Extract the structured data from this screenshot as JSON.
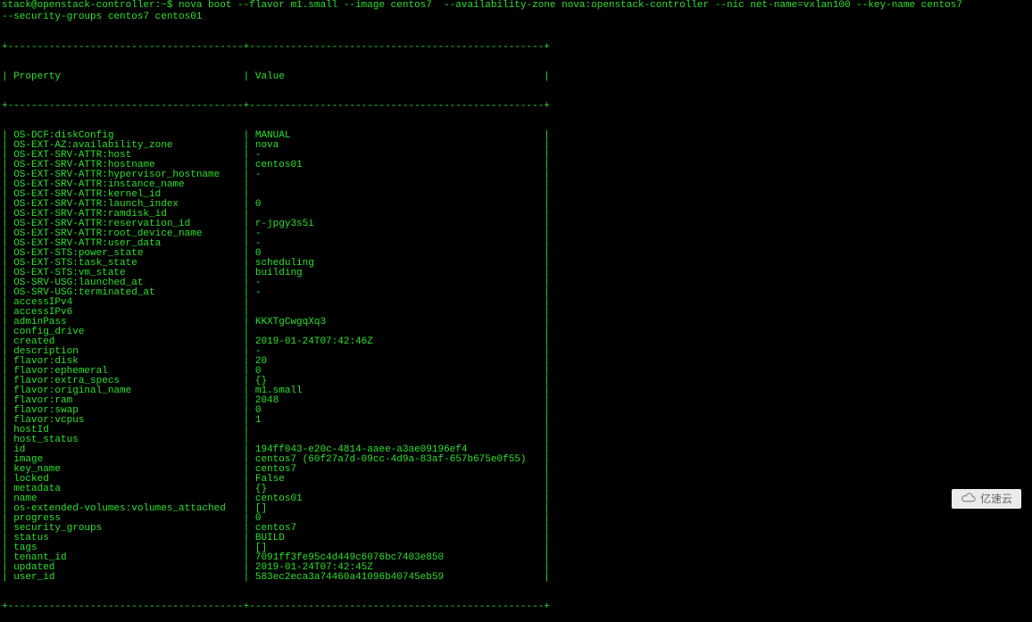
{
  "prompt": {
    "user_host": "stack@openstack-controller:~$",
    "line1": " nova boot --flavor m1.small --image centos7  --availability-zone nova:openstack-controller --nic net-name=vxlan100 --key-name centos7",
    "line2": "--security-groups centos7 centos01"
  },
  "table": {
    "header": {
      "col1": "Property",
      "col2": "Value"
    },
    "rows": [
      {
        "p": "OS-DCF:diskConfig",
        "v": "MANUAL"
      },
      {
        "p": "OS-EXT-AZ:availability_zone",
        "v": "nova"
      },
      {
        "p": "OS-EXT-SRV-ATTR:host",
        "v": "-"
      },
      {
        "p": "OS-EXT-SRV-ATTR:hostname",
        "v": "centos01"
      },
      {
        "p": "OS-EXT-SRV-ATTR:hypervisor_hostname",
        "v": "-"
      },
      {
        "p": "OS-EXT-SRV-ATTR:instance_name",
        "v": ""
      },
      {
        "p": "OS-EXT-SRV-ATTR:kernel_id",
        "v": ""
      },
      {
        "p": "OS-EXT-SRV-ATTR:launch_index",
        "v": "0"
      },
      {
        "p": "OS-EXT-SRV-ATTR:ramdisk_id",
        "v": ""
      },
      {
        "p": "OS-EXT-SRV-ATTR:reservation_id",
        "v": "r-jpgy3s5i"
      },
      {
        "p": "OS-EXT-SRV-ATTR:root_device_name",
        "v": "-"
      },
      {
        "p": "OS-EXT-SRV-ATTR:user_data",
        "v": "-"
      },
      {
        "p": "OS-EXT-STS:power_state",
        "v": "0"
      },
      {
        "p": "OS-EXT-STS:task_state",
        "v": "scheduling"
      },
      {
        "p": "OS-EXT-STS:vm_state",
        "v": "building"
      },
      {
        "p": "OS-SRV-USG:launched_at",
        "v": "-"
      },
      {
        "p": "OS-SRV-USG:terminated_at",
        "v": "-"
      },
      {
        "p": "accessIPv4",
        "v": ""
      },
      {
        "p": "accessIPv6",
        "v": ""
      },
      {
        "p": "adminPass",
        "v": "KKXTgCwgqXq3"
      },
      {
        "p": "config_drive",
        "v": ""
      },
      {
        "p": "created",
        "v": "2019-01-24T07:42:46Z"
      },
      {
        "p": "description",
        "v": "-"
      },
      {
        "p": "flavor:disk",
        "v": "20"
      },
      {
        "p": "flavor:ephemeral",
        "v": "0"
      },
      {
        "p": "flavor:extra_specs",
        "v": "{}"
      },
      {
        "p": "flavor:original_name",
        "v": "m1.small"
      },
      {
        "p": "flavor:ram",
        "v": "2048"
      },
      {
        "p": "flavor:swap",
        "v": "0"
      },
      {
        "p": "flavor:vcpus",
        "v": "1"
      },
      {
        "p": "hostId",
        "v": ""
      },
      {
        "p": "host_status",
        "v": ""
      },
      {
        "p": "id",
        "v": "194ff043-e20c-4814-aaee-a3ae09196ef4"
      },
      {
        "p": "image",
        "v": "centos7 (60f27a7d-09cc-4d9a-83af-657b675e0f55)"
      },
      {
        "p": "key_name",
        "v": "centos7"
      },
      {
        "p": "locked",
        "v": "False"
      },
      {
        "p": "metadata",
        "v": "{}"
      },
      {
        "p": "name",
        "v": "centos01"
      },
      {
        "p": "os-extended-volumes:volumes_attached",
        "v": "[]"
      },
      {
        "p": "progress",
        "v": "0"
      },
      {
        "p": "security_groups",
        "v": "centos7"
      },
      {
        "p": "status",
        "v": "BUILD"
      },
      {
        "p": "tags",
        "v": "[]"
      },
      {
        "p": "tenant_id",
        "v": "7091ff3fe95c4d449c6076bc7403e850"
      },
      {
        "p": "updated",
        "v": "2019-01-24T07:42:45Z"
      },
      {
        "p": "user_id",
        "v": "583ec2eca3a74460a41096b40745eb59"
      }
    ]
  },
  "watermark": "亿速云",
  "col1_width": 38,
  "col2_width": 48
}
